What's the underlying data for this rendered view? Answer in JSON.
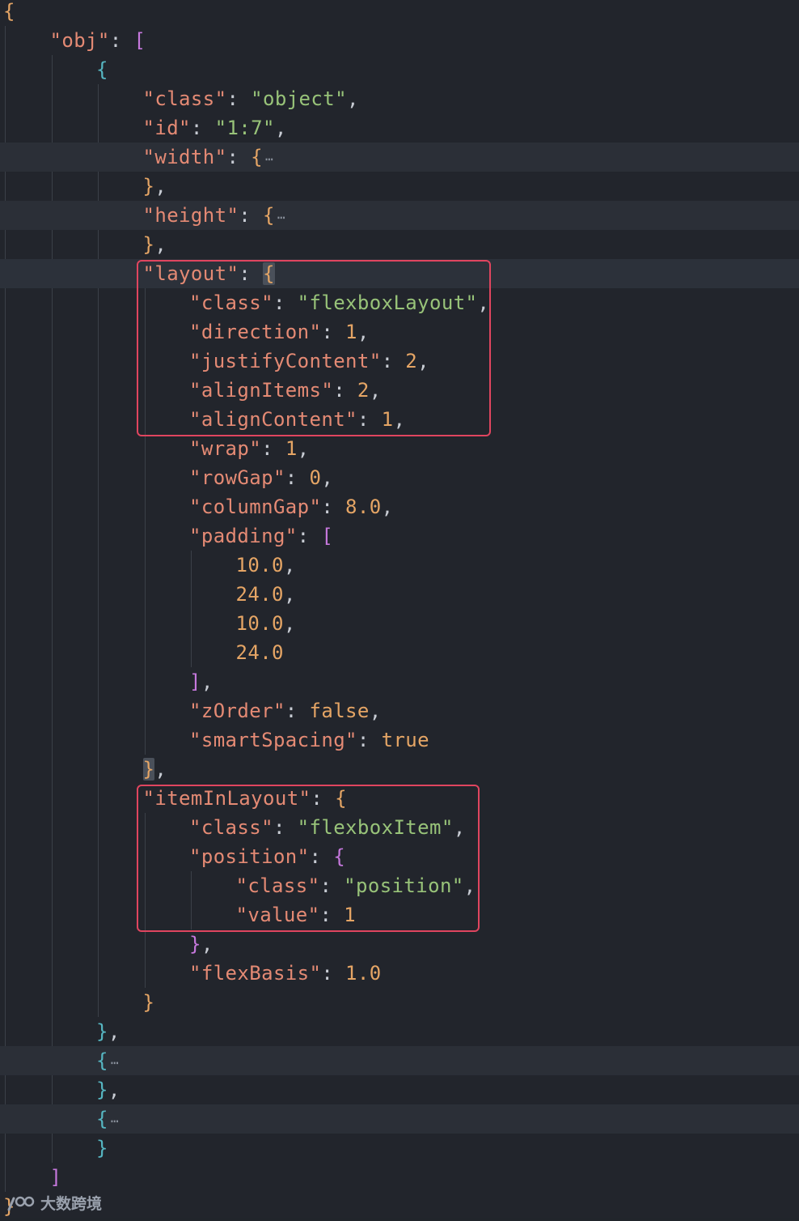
{
  "theme": {
    "background": "#22252c",
    "key": "#e48a74",
    "string": "#98c379",
    "number": "#e5a565",
    "keyword": "#e5a565",
    "punctuation": "#c8ccd4",
    "brace_level_1": "#e5a565",
    "brace_level_2": "#c678dd",
    "brace_level_3": "#56b6c2",
    "fold_ellipsis": "#8a919c",
    "highlight_box": "#e0455f"
  },
  "lines": [
    {
      "indent": 0,
      "tokens": [
        {
          "t": "{",
          "c": "b1"
        }
      ]
    },
    {
      "indent": 1,
      "tokens": [
        {
          "t": "\"obj\"",
          "c": "key"
        },
        {
          "t": ": ",
          "c": "p"
        },
        {
          "t": "[",
          "c": "b2"
        }
      ]
    },
    {
      "indent": 2,
      "tokens": [
        {
          "t": "{",
          "c": "b3"
        }
      ]
    },
    {
      "indent": 3,
      "tokens": [
        {
          "t": "\"class\"",
          "c": "key"
        },
        {
          "t": ": ",
          "c": "p"
        },
        {
          "t": "\"object\"",
          "c": "str"
        },
        {
          "t": ",",
          "c": "p"
        }
      ]
    },
    {
      "indent": 3,
      "tokens": [
        {
          "t": "\"id\"",
          "c": "key"
        },
        {
          "t": ": ",
          "c": "p"
        },
        {
          "t": "\"1:7\"",
          "c": "str"
        },
        {
          "t": ",",
          "c": "p"
        }
      ]
    },
    {
      "indent": 3,
      "folded": true,
      "tokens": [
        {
          "t": "\"width\"",
          "c": "key"
        },
        {
          "t": ": ",
          "c": "p"
        },
        {
          "t": "{",
          "c": "b1"
        },
        {
          "t": "⋯",
          "c": "ell"
        }
      ]
    },
    {
      "indent": 3,
      "tokens": [
        {
          "t": "}",
          "c": "b1"
        },
        {
          "t": ",",
          "c": "p"
        }
      ]
    },
    {
      "indent": 3,
      "folded": true,
      "tokens": [
        {
          "t": "\"height\"",
          "c": "key"
        },
        {
          "t": ": ",
          "c": "p"
        },
        {
          "t": "{",
          "c": "b1"
        },
        {
          "t": "⋯",
          "c": "ell"
        }
      ]
    },
    {
      "indent": 3,
      "tokens": [
        {
          "t": "}",
          "c": "b1"
        },
        {
          "t": ",",
          "c": "p"
        }
      ]
    },
    {
      "indent": 3,
      "cursor": true,
      "tokens": [
        {
          "t": "\"layout\"",
          "c": "key"
        },
        {
          "t": ": ",
          "c": "p"
        },
        {
          "t": "{",
          "c": "b1",
          "m": true
        }
      ]
    },
    {
      "indent": 4,
      "tokens": [
        {
          "t": "\"class\"",
          "c": "key"
        },
        {
          "t": ": ",
          "c": "p"
        },
        {
          "t": "\"flexboxLayout\"",
          "c": "str"
        },
        {
          "t": ",",
          "c": "p"
        }
      ]
    },
    {
      "indent": 4,
      "tokens": [
        {
          "t": "\"direction\"",
          "c": "key"
        },
        {
          "t": ": ",
          "c": "p"
        },
        {
          "t": "1",
          "c": "num"
        },
        {
          "t": ",",
          "c": "p"
        }
      ]
    },
    {
      "indent": 4,
      "tokens": [
        {
          "t": "\"justifyContent\"",
          "c": "key"
        },
        {
          "t": ": ",
          "c": "p"
        },
        {
          "t": "2",
          "c": "num"
        },
        {
          "t": ",",
          "c": "p"
        }
      ]
    },
    {
      "indent": 4,
      "tokens": [
        {
          "t": "\"alignItems\"",
          "c": "key"
        },
        {
          "t": ": ",
          "c": "p"
        },
        {
          "t": "2",
          "c": "num"
        },
        {
          "t": ",",
          "c": "p"
        }
      ]
    },
    {
      "indent": 4,
      "tokens": [
        {
          "t": "\"alignContent\"",
          "c": "key"
        },
        {
          "t": ": ",
          "c": "p"
        },
        {
          "t": "1",
          "c": "num"
        },
        {
          "t": ",",
          "c": "p"
        }
      ]
    },
    {
      "indent": 4,
      "tokens": [
        {
          "t": "\"wrap\"",
          "c": "key"
        },
        {
          "t": ": ",
          "c": "p"
        },
        {
          "t": "1",
          "c": "num"
        },
        {
          "t": ",",
          "c": "p"
        }
      ]
    },
    {
      "indent": 4,
      "tokens": [
        {
          "t": "\"rowGap\"",
          "c": "key"
        },
        {
          "t": ": ",
          "c": "p"
        },
        {
          "t": "0",
          "c": "num"
        },
        {
          "t": ",",
          "c": "p"
        }
      ]
    },
    {
      "indent": 4,
      "tokens": [
        {
          "t": "\"columnGap\"",
          "c": "key"
        },
        {
          "t": ": ",
          "c": "p"
        },
        {
          "t": "8.0",
          "c": "num"
        },
        {
          "t": ",",
          "c": "p"
        }
      ]
    },
    {
      "indent": 4,
      "tokens": [
        {
          "t": "\"padding\"",
          "c": "key"
        },
        {
          "t": ": ",
          "c": "p"
        },
        {
          "t": "[",
          "c": "b2"
        }
      ]
    },
    {
      "indent": 5,
      "tokens": [
        {
          "t": "10.0",
          "c": "num"
        },
        {
          "t": ",",
          "c": "p"
        }
      ]
    },
    {
      "indent": 5,
      "tokens": [
        {
          "t": "24.0",
          "c": "num"
        },
        {
          "t": ",",
          "c": "p"
        }
      ]
    },
    {
      "indent": 5,
      "tokens": [
        {
          "t": "10.0",
          "c": "num"
        },
        {
          "t": ",",
          "c": "p"
        }
      ]
    },
    {
      "indent": 5,
      "tokens": [
        {
          "t": "24.0",
          "c": "num"
        }
      ]
    },
    {
      "indent": 4,
      "tokens": [
        {
          "t": "]",
          "c": "b2"
        },
        {
          "t": ",",
          "c": "p"
        }
      ]
    },
    {
      "indent": 4,
      "tokens": [
        {
          "t": "\"zOrder\"",
          "c": "key"
        },
        {
          "t": ": ",
          "c": "p"
        },
        {
          "t": "false",
          "c": "kw"
        },
        {
          "t": ",",
          "c": "p"
        }
      ]
    },
    {
      "indent": 4,
      "tokens": [
        {
          "t": "\"smartSpacing\"",
          "c": "key"
        },
        {
          "t": ": ",
          "c": "p"
        },
        {
          "t": "true",
          "c": "kw"
        }
      ]
    },
    {
      "indent": 3,
      "tokens": [
        {
          "t": "}",
          "c": "b1",
          "m": true
        },
        {
          "t": ",",
          "c": "p"
        }
      ]
    },
    {
      "indent": 3,
      "tokens": [
        {
          "t": "\"itemInLayout\"",
          "c": "key"
        },
        {
          "t": ": ",
          "c": "p"
        },
        {
          "t": "{",
          "c": "b1"
        }
      ]
    },
    {
      "indent": 4,
      "tokens": [
        {
          "t": "\"class\"",
          "c": "key"
        },
        {
          "t": ": ",
          "c": "p"
        },
        {
          "t": "\"flexboxItem\"",
          "c": "str"
        },
        {
          "t": ",",
          "c": "p"
        }
      ]
    },
    {
      "indent": 4,
      "tokens": [
        {
          "t": "\"position\"",
          "c": "key"
        },
        {
          "t": ": ",
          "c": "p"
        },
        {
          "t": "{",
          "c": "b2"
        }
      ]
    },
    {
      "indent": 5,
      "tokens": [
        {
          "t": "\"class\"",
          "c": "key"
        },
        {
          "t": ": ",
          "c": "p"
        },
        {
          "t": "\"position\"",
          "c": "str"
        },
        {
          "t": ",",
          "c": "p"
        }
      ]
    },
    {
      "indent": 5,
      "tokens": [
        {
          "t": "\"value\"",
          "c": "key"
        },
        {
          "t": ": ",
          "c": "p"
        },
        {
          "t": "1",
          "c": "num"
        }
      ]
    },
    {
      "indent": 4,
      "tokens": [
        {
          "t": "}",
          "c": "b2"
        },
        {
          "t": ",",
          "c": "p"
        }
      ]
    },
    {
      "indent": 4,
      "tokens": [
        {
          "t": "\"flexBasis\"",
          "c": "key"
        },
        {
          "t": ": ",
          "c": "p"
        },
        {
          "t": "1.0",
          "c": "num"
        }
      ]
    },
    {
      "indent": 3,
      "tokens": [
        {
          "t": "}",
          "c": "b1"
        }
      ]
    },
    {
      "indent": 2,
      "tokens": [
        {
          "t": "}",
          "c": "b3"
        },
        {
          "t": ",",
          "c": "p"
        }
      ]
    },
    {
      "indent": 2,
      "folded": true,
      "tokens": [
        {
          "t": "{",
          "c": "b3"
        },
        {
          "t": "⋯",
          "c": "ell"
        }
      ]
    },
    {
      "indent": 2,
      "tokens": [
        {
          "t": "}",
          "c": "b3"
        },
        {
          "t": ",",
          "c": "p"
        }
      ]
    },
    {
      "indent": 2,
      "folded": true,
      "tokens": [
        {
          "t": "{",
          "c": "b3"
        },
        {
          "t": "⋯",
          "c": "ell"
        }
      ]
    },
    {
      "indent": 2,
      "tokens": [
        {
          "t": "}",
          "c": "b3"
        }
      ]
    },
    {
      "indent": 1,
      "tokens": [
        {
          "t": "]",
          "c": "b2"
        }
      ]
    },
    {
      "indent": 0,
      "tokens": [
        {
          "t": "}",
          "c": "b1"
        }
      ]
    }
  ],
  "highlight_boxes": [
    {
      "name": "layout-highlight-box",
      "from_line": 9,
      "to_line": 14
    },
    {
      "name": "item-in-layout-highlight-box",
      "from_line": 27,
      "to_line": 31
    }
  ],
  "watermark": {
    "text": "大数跨境",
    "icon": "chain-logo-icon"
  }
}
